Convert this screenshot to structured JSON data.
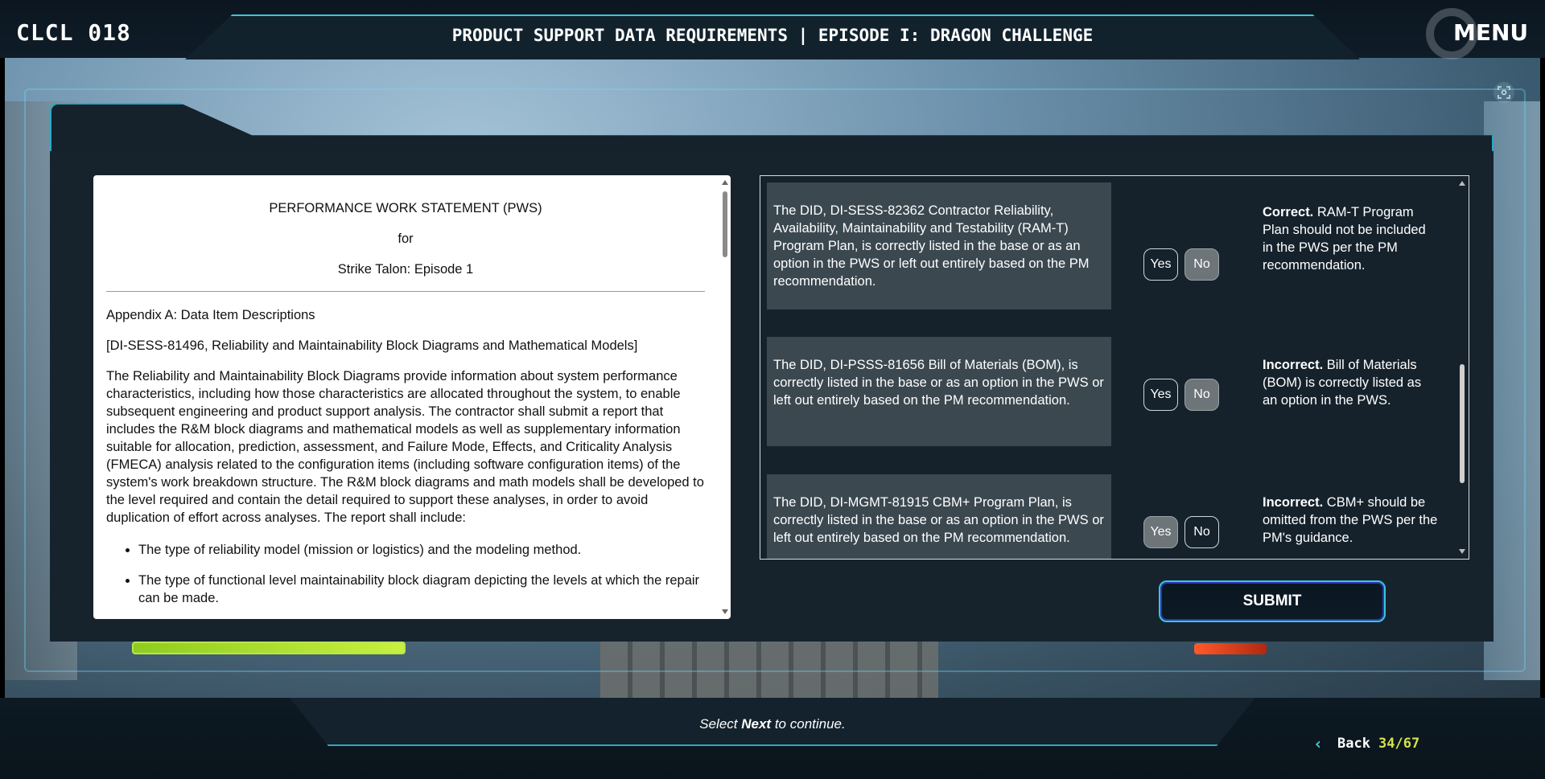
{
  "header": {
    "course_code": "CLCL 018",
    "title": "PRODUCT SUPPORT DATA REQUIREMENTS | EPISODE I: DRAGON CHALLENGE",
    "menu_label": "MENU"
  },
  "document": {
    "title": "PERFORMANCE WORK STATEMENT (PWS)",
    "for": "for",
    "subtitle": "Strike Talon: Episode 1",
    "appendix": "Appendix A: Data Item Descriptions",
    "did_heading": "[DI-SESS-81496, Reliability and Maintainability Block Diagrams and Mathematical Models]",
    "body": "The Reliability and Maintainability Block Diagrams provide information about system performance characteristics, including how those characteristics are allocated throughout the system, to enable subsequent engineering and product support analysis. The contractor shall submit a report that includes the R&M block diagrams and mathematical models as well as supplementary information suitable for allocation, prediction, assessment, and Failure Mode, Effects, and Criticality Analysis (FMECA) analysis related to the configuration items (including software configuration items) of the system's work breakdown structure. The R&M block diagrams and math models shall be developed to the level required and contain the detail required to support these analyses, in order to avoid duplication of effort across analyses. The report shall include:",
    "bullets": [
      "The type of reliability model (mission or logistics) and the modeling method.",
      "The type of functional level maintainability block diagram depicting the levels at which the repair can be made."
    ]
  },
  "questions": [
    {
      "text": "The DID, DI-SESS-82362 Contractor Reliability, Availability, Maintainability and Testability (RAM-T) Program Plan, is correctly listed in the base or as an option in the PWS or left out entirely based on the PM recommendation.",
      "yes_label": "Yes",
      "no_label": "No",
      "selected": "No",
      "feedback_status": "Correct.",
      "feedback_text": " RAM-T Program Plan should not be included in the PWS per the PM recommendation."
    },
    {
      "text": "The DID, DI-PSSS-81656 Bill of Materials (BOM), is correctly listed in the base or as an option in the PWS or left out entirely based on the PM recommendation.",
      "yes_label": "Yes",
      "no_label": "No",
      "selected": "No",
      "feedback_status": "Incorrect.",
      "feedback_text": " Bill of Materials (BOM) is correctly listed as an option in the PWS."
    },
    {
      "text": "The DID, DI-MGMT-81915 CBM+ Program Plan, is correctly listed in the base or as an option in the PWS or left out entirely based on the PM recommendation.",
      "yes_label": "Yes",
      "no_label": "No",
      "selected": "Yes",
      "feedback_status": "Incorrect.",
      "feedback_text": " CBM+ should be omitted from the PWS per the PM's guidance."
    }
  ],
  "submit_label": "SUBMIT",
  "footer": {
    "instruction_pre": "Select ",
    "instruction_bold": "Next",
    "instruction_post": " to continue.",
    "back_label": "Back",
    "page_count": "34/67"
  },
  "icons": {
    "menu": "menu-ring-icon",
    "screenshot": "screenshot-icon",
    "back": "chevron-left-icon"
  },
  "colors": {
    "accent": "#3fc2d8",
    "page_count": "#d4e14a",
    "selected_button": "#6d7579"
  }
}
